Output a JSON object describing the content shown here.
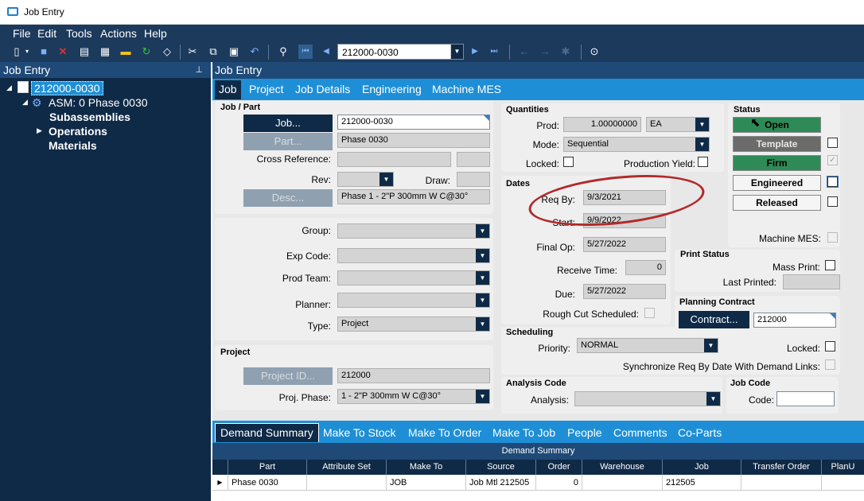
{
  "window": {
    "title": "Job Entry"
  },
  "menu": [
    "File",
    "Edit",
    "Tools",
    "Actions",
    "Help"
  ],
  "toolbar": {
    "job_combo": "212000-0030"
  },
  "tree": {
    "header": "Job Entry",
    "root": "212000-0030",
    "asm": "ASM: 0 Phase 0030",
    "subassemblies": "Subassemblies",
    "operations": "Operations",
    "materials": "Materials"
  },
  "main": {
    "header": "Job Entry",
    "tabs": [
      "Job",
      "Project",
      "Job Details",
      "Engineering",
      "Machine MES"
    ]
  },
  "job_part": {
    "section": "Job / Part",
    "job_btn": "Job...",
    "job_value": "212000-0030",
    "part_btn": "Part...",
    "part_value": "Phase 0030",
    "cross_ref_label": "Cross Reference:",
    "rev_label": "Rev:",
    "draw_label": "Draw:",
    "desc_btn": "Desc...",
    "desc_value": "Phase 1 - 2\"P 300mm W C@30°"
  },
  "classification": {
    "group_label": "Group:",
    "exp_code_label": "Exp Code:",
    "prod_team_label": "Prod Team:",
    "planner_label": "Planner:",
    "type_label": "Type:",
    "type_value": "Project"
  },
  "project": {
    "section": "Project",
    "project_id_btn": "Project ID...",
    "project_id_value": "212000",
    "phase_label": "Proj. Phase:",
    "phase_value": "1 - 2\"P 300mm W C@30°"
  },
  "quantities": {
    "section": "Quantities",
    "prod_label": "Prod:",
    "prod_value": "1.00000000",
    "uom": "EA",
    "mode_label": "Mode:",
    "mode_value": "Sequential",
    "locked_label": "Locked:",
    "prod_yield_label": "Production Yield:"
  },
  "dates": {
    "section": "Dates",
    "req_by_label": "Req By:",
    "req_by_value": "9/3/2021",
    "start_label": "Start:",
    "start_value": "9/9/2022",
    "final_op_label": "Final Op:",
    "final_op_value": "5/27/2022",
    "receive_time_label": "Receive Time:",
    "receive_time_value": "0",
    "due_label": "Due:",
    "due_value": "5/27/2022",
    "rough_cut_label": "Rough Cut Scheduled:"
  },
  "scheduling": {
    "section": "Scheduling",
    "priority_label": "Priority:",
    "priority_value": "NORMAL",
    "locked_label": "Locked:",
    "sync_label": "Synchronize Req By Date With Demand Links:"
  },
  "analysis": {
    "section": "Analysis Code",
    "label": "Analysis:"
  },
  "job_code": {
    "section": "Job Code",
    "label": "Code:"
  },
  "status": {
    "section": "Status",
    "open": "Open",
    "template": "Template",
    "firm": "Firm",
    "engineered": "Engineered",
    "released": "Released",
    "machine_mes_label": "Machine MES:"
  },
  "print_status": {
    "section": "Print Status",
    "mass_print_label": "Mass Print:",
    "last_printed_label": "Last Printed:"
  },
  "planning": {
    "section": "Planning Contract",
    "contract_btn": "Contract...",
    "contract_value": "212000"
  },
  "bottom_tabs": [
    "Demand Summary",
    "Make To Stock",
    "Make To Order",
    "Make To Job",
    "People",
    "Comments",
    "Co-Parts"
  ],
  "demand_grid": {
    "title": "Demand Summary",
    "columns": [
      "Part",
      "Attribute Set",
      "Make To",
      "Source",
      "Order",
      "Warehouse",
      "Job",
      "Transfer Order",
      "PlanU"
    ],
    "rows": [
      [
        "Phase 0030",
        "",
        "JOB",
        "Job Mtl 212505",
        "0",
        "",
        "212505",
        "",
        ""
      ]
    ]
  },
  "colors": {
    "nav_dark": "#0f2a47",
    "tab_blue": "#1e8fd6",
    "status_green": "#2e8b57",
    "annotation_red": "#b22a2a"
  }
}
